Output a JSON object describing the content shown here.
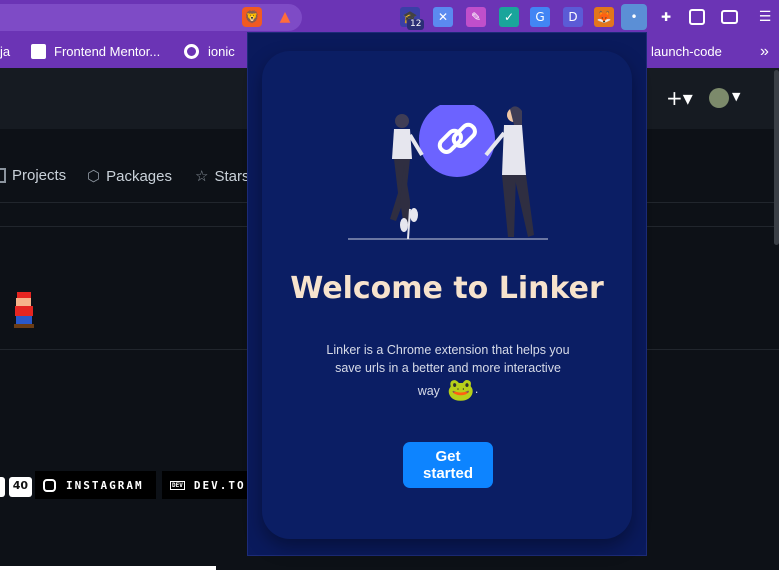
{
  "browser": {
    "extension_badge": "12",
    "bookmarks": [
      {
        "label": "ja",
        "icon": "bookmark-icon"
      },
      {
        "label": "Frontend Mentor...",
        "icon": "frontend-mentor-icon"
      },
      {
        "label": "ionic",
        "icon": "ionic-icon"
      },
      {
        "label": "launch-code",
        "icon": "folder-icon"
      }
    ]
  },
  "github": {
    "nav": [
      "Projects",
      "Packages",
      "Stars"
    ],
    "badges": {
      "count": "40",
      "instagram": "INSTAGRAM",
      "devto": "DEV.TO",
      "devto_logo": "DEV"
    }
  },
  "popup": {
    "title": "Welcome to Linker",
    "description": "Linker is a Chrome extension that helps you save urls in a better and more interactive",
    "description_tail": "way",
    "emoji": "🐸",
    "period": ".",
    "button_label_line1": "Get",
    "button_label_line2": "started",
    "colors": {
      "background": "#0a1a5c",
      "title": "#f7e3cd",
      "button": "#0d84ff",
      "illustration_accent": "#6c63ff"
    }
  }
}
